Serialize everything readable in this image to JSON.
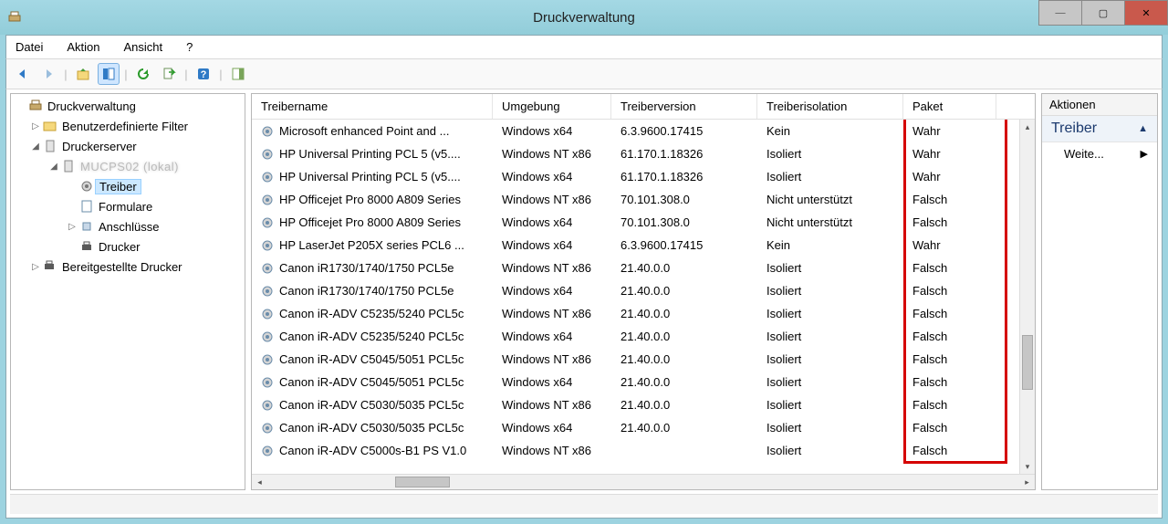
{
  "window": {
    "title": "Druckverwaltung"
  },
  "menu": {
    "file": "Datei",
    "action": "Aktion",
    "view": "Ansicht",
    "help": "?"
  },
  "tree": {
    "root": "Druckverwaltung",
    "custom_filters": "Benutzerdefinierte Filter",
    "print_servers": "Druckerserver",
    "server_name": "MUCPS02 (lokal)",
    "drivers": "Treiber",
    "forms": "Formulare",
    "ports": "Anschlüsse",
    "printers": "Drucker",
    "deployed": "Bereitgestellte Drucker"
  },
  "columns": {
    "name": "Treibername",
    "env": "Umgebung",
    "ver": "Treiberversion",
    "iso": "Treiberisolation",
    "pkg": "Paket"
  },
  "rows": [
    {
      "name": "Microsoft enhanced Point and ...",
      "env": "Windows x64",
      "ver": "6.3.9600.17415",
      "iso": "Kein",
      "pkg": "Wahr"
    },
    {
      "name": "HP Universal Printing PCL 5 (v5....",
      "env": "Windows NT x86",
      "ver": "61.170.1.18326",
      "iso": "Isoliert",
      "pkg": "Wahr"
    },
    {
      "name": "HP Universal Printing PCL 5 (v5....",
      "env": "Windows x64",
      "ver": "61.170.1.18326",
      "iso": "Isoliert",
      "pkg": "Wahr"
    },
    {
      "name": "HP Officejet Pro 8000 A809 Series",
      "env": "Windows NT x86",
      "ver": "70.101.308.0",
      "iso": "Nicht unterstützt",
      "pkg": "Falsch"
    },
    {
      "name": "HP Officejet Pro 8000 A809 Series",
      "env": "Windows x64",
      "ver": "70.101.308.0",
      "iso": "Nicht unterstützt",
      "pkg": "Falsch"
    },
    {
      "name": "HP LaserJet P205X series PCL6 ...",
      "env": "Windows x64",
      "ver": "6.3.9600.17415",
      "iso": "Kein",
      "pkg": "Wahr"
    },
    {
      "name": "Canon iR1730/1740/1750 PCL5e",
      "env": "Windows NT x86",
      "ver": "21.40.0.0",
      "iso": "Isoliert",
      "pkg": "Falsch"
    },
    {
      "name": "Canon iR1730/1740/1750 PCL5e",
      "env": "Windows x64",
      "ver": "21.40.0.0",
      "iso": "Isoliert",
      "pkg": "Falsch"
    },
    {
      "name": "Canon iR-ADV C5235/5240 PCL5c",
      "env": "Windows NT x86",
      "ver": "21.40.0.0",
      "iso": "Isoliert",
      "pkg": "Falsch"
    },
    {
      "name": "Canon iR-ADV C5235/5240 PCL5c",
      "env": "Windows x64",
      "ver": "21.40.0.0",
      "iso": "Isoliert",
      "pkg": "Falsch"
    },
    {
      "name": "Canon iR-ADV C5045/5051 PCL5c",
      "env": "Windows NT x86",
      "ver": "21.40.0.0",
      "iso": "Isoliert",
      "pkg": "Falsch"
    },
    {
      "name": "Canon iR-ADV C5045/5051 PCL5c",
      "env": "Windows x64",
      "ver": "21.40.0.0",
      "iso": "Isoliert",
      "pkg": "Falsch"
    },
    {
      "name": "Canon iR-ADV C5030/5035 PCL5c",
      "env": "Windows NT x86",
      "ver": "21.40.0.0",
      "iso": "Isoliert",
      "pkg": "Falsch"
    },
    {
      "name": "Canon iR-ADV C5030/5035 PCL5c",
      "env": "Windows x64",
      "ver": "21.40.0.0",
      "iso": "Isoliert",
      "pkg": "Falsch"
    },
    {
      "name": "Canon iR-ADV C5000s-B1 PS V1.0",
      "env": "Windows NT x86",
      "ver": "",
      "iso": "Isoliert",
      "pkg": "Falsch"
    }
  ],
  "actions": {
    "pane_title": "Aktionen",
    "section": "Treiber",
    "more": "Weite..."
  }
}
